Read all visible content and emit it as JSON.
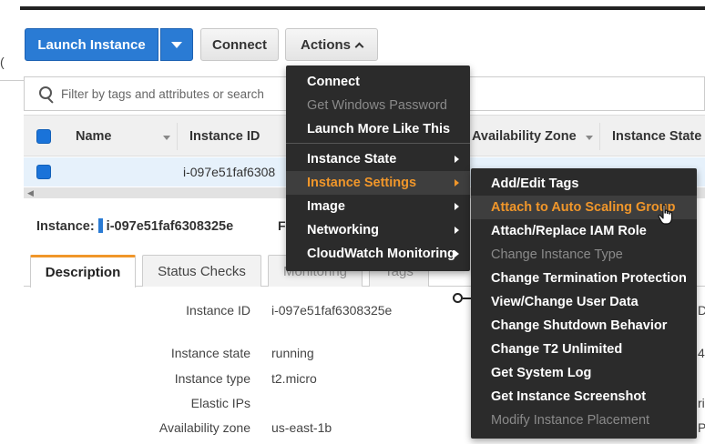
{
  "toolbar": {
    "launch_label": "Launch Instance",
    "connect_label": "Connect",
    "actions_label": "Actions"
  },
  "left_fragment": "(",
  "filter": {
    "placeholder": "Filter by tags and attributes or search"
  },
  "table": {
    "columns": [
      "Name",
      "Instance ID",
      "Availability Zone",
      "Instance State"
    ],
    "rows": [
      {
        "instance_id": "i-097e51faf6308"
      }
    ]
  },
  "instance_bar": {
    "prefix": "Instance:",
    "id": "i-097e51faf6308325e",
    "trailing_fragment": "F"
  },
  "tabs": [
    "Description",
    "Status Checks",
    "Monitoring",
    "Tags"
  ],
  "details": [
    {
      "label": "Instance ID",
      "value": "i-097e51faf6308325e"
    },
    {
      "label": "Instance state",
      "value": "running"
    },
    {
      "label": "Instance type",
      "value": "t2.micro"
    },
    {
      "label": "Elastic IPs",
      "value": ""
    },
    {
      "label": "Availability zone",
      "value": "us-east-1b"
    }
  ],
  "right_fragments": [
    "D",
    "4",
    "ri",
    "P"
  ],
  "actions_menu": {
    "items": [
      {
        "label": "Connect",
        "disabled": false
      },
      {
        "label": "Get Windows Password",
        "disabled": true
      },
      {
        "label": "Launch More Like This",
        "disabled": false
      },
      {
        "label": "Instance State",
        "disabled": false,
        "submenu": true
      },
      {
        "label": "Instance Settings",
        "disabled": false,
        "submenu": true,
        "active": true
      },
      {
        "label": "Image",
        "disabled": false,
        "submenu": true
      },
      {
        "label": "Networking",
        "disabled": false,
        "submenu": true
      },
      {
        "label": "CloudWatch Monitoring",
        "disabled": false,
        "submenu": true
      }
    ]
  },
  "settings_submenu": {
    "items": [
      {
        "label": "Add/Edit Tags",
        "disabled": false
      },
      {
        "label": "Attach to Auto Scaling Group",
        "disabled": false,
        "active": true
      },
      {
        "label": "Attach/Replace IAM Role",
        "disabled": false
      },
      {
        "label": "Change Instance Type",
        "disabled": true
      },
      {
        "label": "Change Termination Protection",
        "disabled": false
      },
      {
        "label": "View/Change User Data",
        "disabled": false
      },
      {
        "label": "Change Shutdown Behavior",
        "disabled": false
      },
      {
        "label": "Change T2 Unlimited",
        "disabled": false
      },
      {
        "label": "Get System Log",
        "disabled": false
      },
      {
        "label": "Get Instance Screenshot",
        "disabled": false
      },
      {
        "label": "Modify Instance Placement",
        "disabled": true
      }
    ]
  },
  "colors": {
    "primary": "#2a7bd4",
    "menu_bg": "#2b2b2b",
    "highlight": "#f0962a",
    "selected_row": "#e6f1fb"
  }
}
